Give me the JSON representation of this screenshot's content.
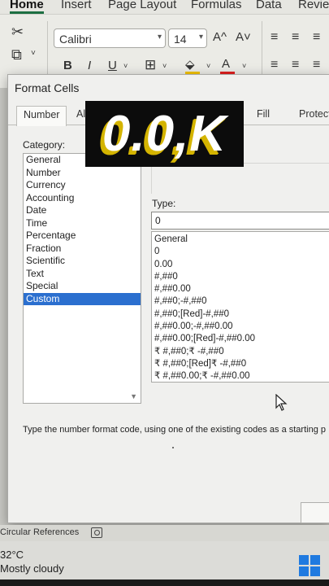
{
  "ribbon": {
    "tabs": [
      "Home",
      "Insert",
      "Page Layout",
      "Formulas",
      "Data",
      "Review"
    ],
    "font_name": "Calibri",
    "font_size": "14",
    "grow_font": "A^",
    "shrink_font": "A˅",
    "bold": "B",
    "italic": "I",
    "underline": "U",
    "font_color_glyph": "A",
    "accent_color": "#1d6f42",
    "font_color": "#e02020",
    "fill_color": "#f2c200"
  },
  "dialog": {
    "title": "Format Cells",
    "tabs": [
      "Number",
      "Al",
      "Fill",
      "Protecti"
    ],
    "category_label": "Category:",
    "categories": [
      "General",
      "Number",
      "Currency",
      "Accounting",
      "Date",
      "Time",
      "Percentage",
      "Fraction",
      "Scientific",
      "Text",
      "Special",
      "Custom"
    ],
    "selected_category": "Custom",
    "type_label": "Type:",
    "type_value": "0",
    "formats": [
      "General",
      "0",
      "0.00",
      "#,##0",
      "#,##0.00",
      "#,##0;-#,##0",
      "#,##0;[Red]-#,##0",
      "#,##0.00;-#,##0.00",
      "#,##0.00;[Red]-#,##0.00",
      "₹ #,##0;₹ -#,##0",
      "₹ #,##0;[Red]₹ -#,##0",
      "₹ #,##0.00;₹ -#,##0.00"
    ],
    "hint": "Type the number format code, using one of the existing codes as a starting p"
  },
  "overlay": {
    "text": "0.0,K",
    "shadow_color": "#d4b400"
  },
  "statusbar": {
    "text": "Circular References"
  },
  "taskbar": {
    "temperature": "32°C",
    "weather": "Mostly cloudy",
    "windows_color": "#1f7ae0"
  }
}
